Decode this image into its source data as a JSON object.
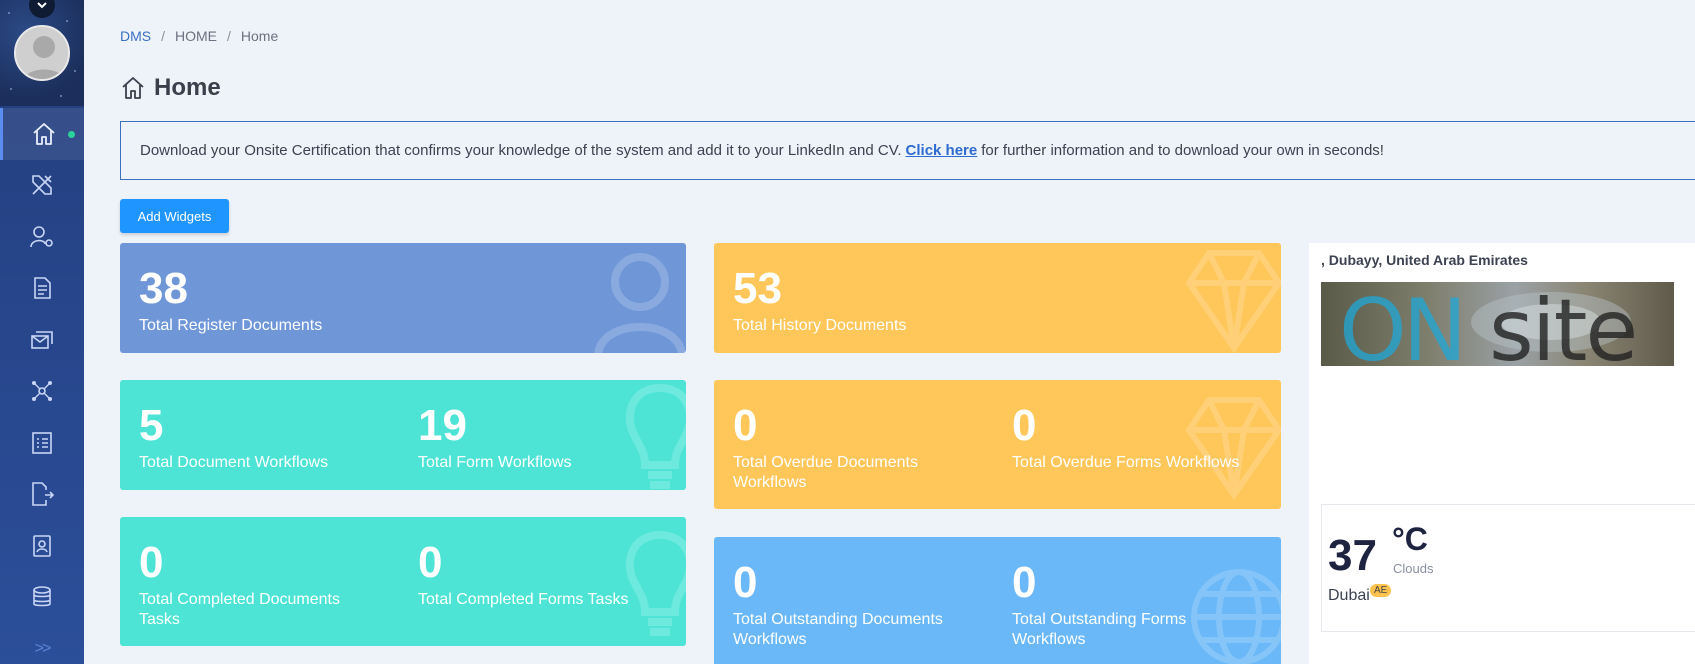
{
  "sidebar": {
    "items": [
      {
        "icon": "home-icon",
        "active": true
      },
      {
        "icon": "design-tools-icon"
      },
      {
        "icon": "user-settings-icon"
      },
      {
        "icon": "document-icon"
      },
      {
        "icon": "mail-stack-icon"
      },
      {
        "icon": "network-icon"
      },
      {
        "icon": "checklist-icon"
      },
      {
        "icon": "file-export-icon"
      },
      {
        "icon": "contacts-icon"
      },
      {
        "icon": "database-icon"
      }
    ],
    "expand_label": ">>"
  },
  "breadcrumb": {
    "root": "DMS",
    "section": "HOME",
    "current": "Home"
  },
  "page": {
    "title": "Home"
  },
  "banner": {
    "text_before": "Download your Onsite Certification that confirms your knowledge of the system and add it to your LinkedIn and CV.",
    "link": "Click here",
    "text_after": "for further information and to download your own in seconds!"
  },
  "toolbar": {
    "add_widgets_label": "Add Widgets"
  },
  "cards": {
    "register": {
      "value": "38",
      "label": "Total Register Documents"
    },
    "history": {
      "value": "53",
      "label": "Total History Documents"
    },
    "doc_workflows": {
      "value": "5",
      "label": "Total Document Workflows"
    },
    "form_workflows": {
      "value": "19",
      "label": "Total Form Workflows"
    },
    "overdue_docs": {
      "value": "0",
      "label": "Total Overdue Documents Workflows"
    },
    "overdue_forms": {
      "value": "0",
      "label": "Total Overdue Forms Workflows"
    },
    "completed_docs": {
      "value": "0",
      "label": "Total Completed Documents Tasks"
    },
    "completed_forms": {
      "value": "0",
      "label": "Total Completed Forms Tasks"
    },
    "outstanding_docs": {
      "value": "0",
      "label": "Total Outstanding Documents Workflows"
    },
    "outstanding_forms": {
      "value": "0",
      "label": "Total Outstanding Forms Workflows"
    }
  },
  "weather": {
    "location": ", Dubayy, United Arab Emirates",
    "logo_text": "ONsite",
    "temperature": "37",
    "unit": "°C",
    "condition": "Clouds",
    "city": "Dubai",
    "country": "AE"
  },
  "colors": {
    "sidebar": "#27468c",
    "card_blue": "#6f97d8",
    "card_yellow": "#ffc65a",
    "card_teal": "#4de4d6",
    "card_light_blue": "#6ab8f7",
    "button": "#1f95ff"
  }
}
